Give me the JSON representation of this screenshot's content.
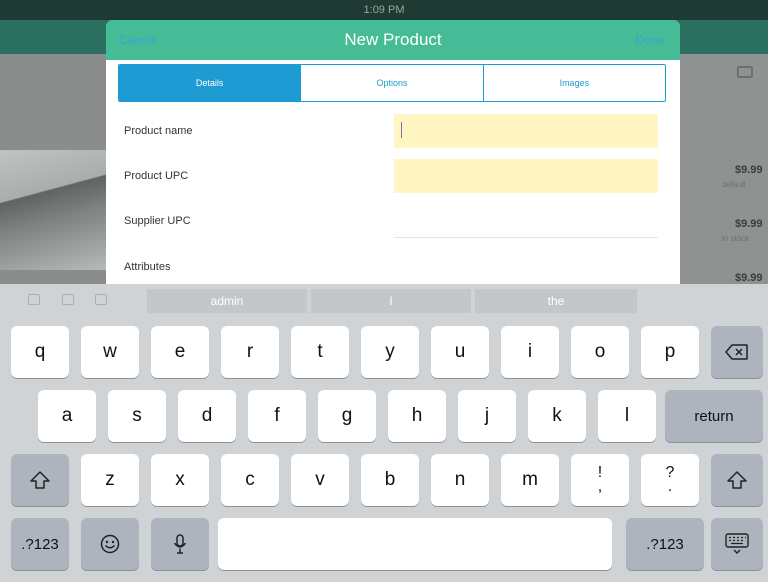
{
  "background": {
    "status_time": "1:09 PM",
    "prices": [
      "$9.99",
      "$9.99",
      "$9.99"
    ],
    "price_notes": [
      "default",
      "in stock"
    ]
  },
  "modal": {
    "title": "New Product",
    "cancel_label": "Cancel",
    "done_label": "Done",
    "tabs": [
      {
        "label": "Details",
        "active": true
      },
      {
        "label": "Options",
        "active": false
      },
      {
        "label": "Images",
        "active": false
      }
    ],
    "fields": [
      {
        "label": "Product name",
        "value": "",
        "placeholder": ""
      },
      {
        "label": "Product UPC",
        "value": "",
        "placeholder": ""
      },
      {
        "label": "Supplier UPC",
        "value": "",
        "placeholder": ""
      },
      {
        "label": "Attributes",
        "value": "",
        "placeholder": ""
      }
    ]
  },
  "keyboard": {
    "predictions": [
      "admin",
      "I",
      "the"
    ],
    "row1": [
      "q",
      "w",
      "e",
      "r",
      "t",
      "y",
      "u",
      "i",
      "o",
      "p"
    ],
    "row2": [
      "a",
      "s",
      "d",
      "f",
      "g",
      "h",
      "j",
      "k",
      "l"
    ],
    "row3": [
      "z",
      "x",
      "c",
      "v",
      "b",
      "n",
      "m"
    ],
    "punct1": {
      "top": "!",
      "bottom": ","
    },
    "punct2": {
      "top": "?",
      "bottom": "."
    },
    "return_label": "return",
    "numbers_label": ".?123",
    "key_color": "#ffffff",
    "dark_key_color": "#adb4bd",
    "accent": "#45bb96",
    "tab_accent": "#1e9bd2"
  }
}
